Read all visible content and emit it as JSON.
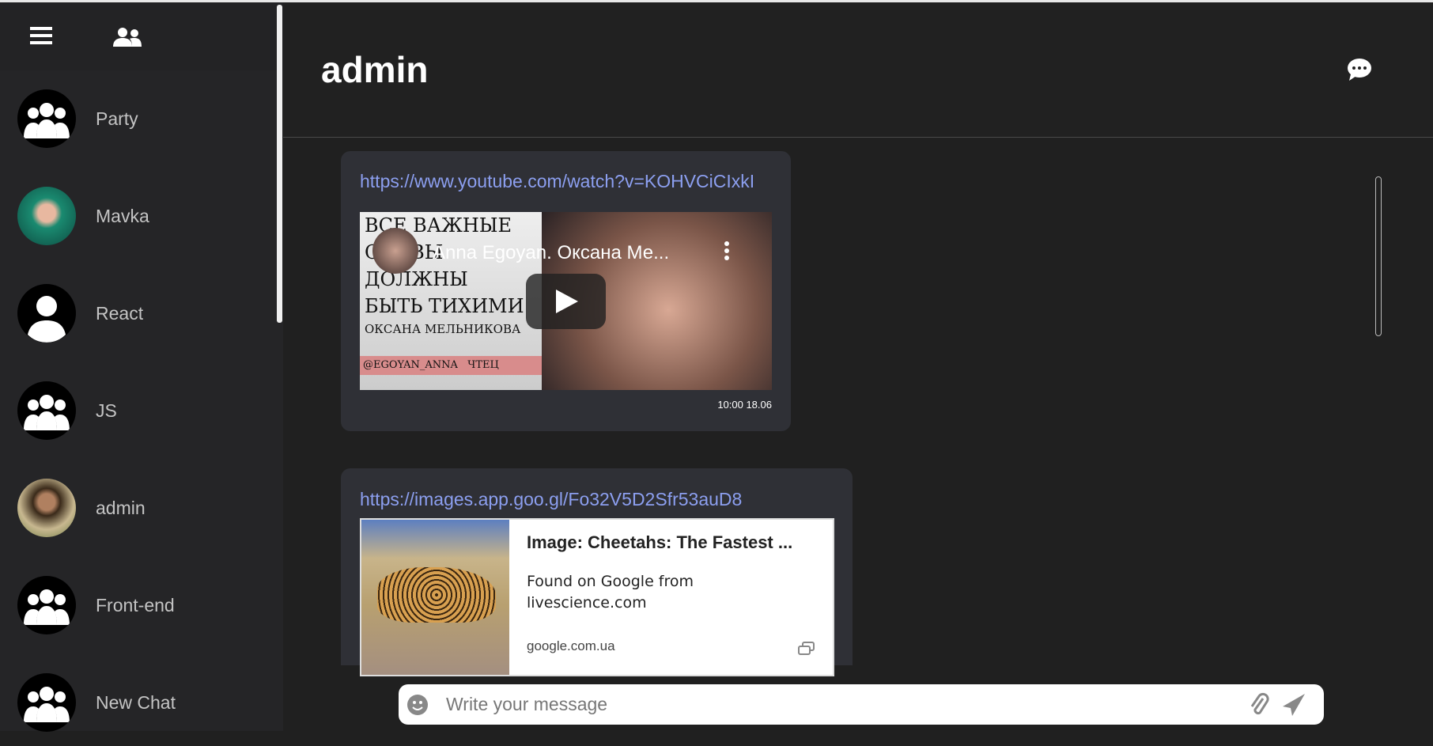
{
  "sidebar": {
    "chats": [
      {
        "name": "Party",
        "avatar": "group"
      },
      {
        "name": "Mavka",
        "avatar": "photo"
      },
      {
        "name": "React",
        "avatar": "user"
      },
      {
        "name": "JS",
        "avatar": "group"
      },
      {
        "name": "admin",
        "avatar": "photo"
      },
      {
        "name": "Front-end",
        "avatar": "group"
      },
      {
        "name": "New Chat",
        "avatar": "group"
      }
    ]
  },
  "header": {
    "title": "admin"
  },
  "messages": [
    {
      "link": "https://www.youtube.com/watch?v=KOHVCiCIxkI",
      "video_title": "Anna Egoyan. Оксана Ме...",
      "thumb_lines": [
        "ВСЕ ВАЖНЫЕ",
        "СЛОВЫ",
        "ДОЛЖНЫ",
        "БЫТЬ ТИХИМИ",
        "ОКСАНА МЕЛЬНИКОВА",
        "@EGOYAN_ANNA   ЧТЕЦ"
      ],
      "time": "10:00 18.06"
    },
    {
      "link": "https://images.app.goo.gl/Fo32V5D2Sfr53auD8",
      "card_title": "Image: Cheetahs: The Fastest ...",
      "card_desc": "Found on Google from livescience.com",
      "card_domain": "google.com.ua"
    }
  ],
  "composer": {
    "placeholder": "Write your message"
  },
  "colors": {
    "link": "#8c9ff0",
    "bubble": "#2f3036",
    "sidebar": "#252527"
  }
}
